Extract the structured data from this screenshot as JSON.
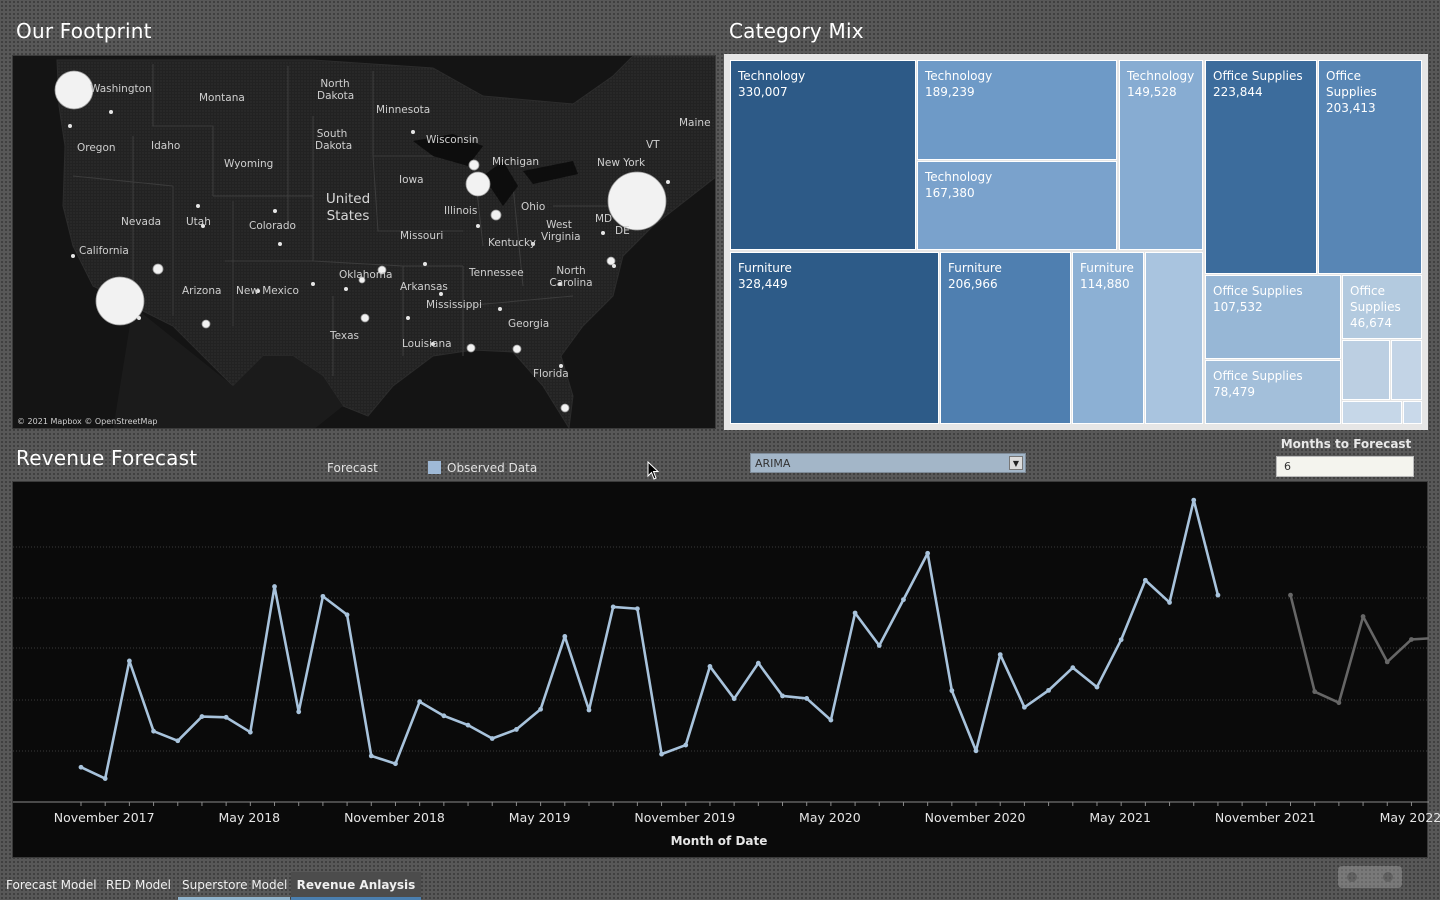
{
  "footprint": {
    "title": "Our Footprint",
    "credit": "© 2021 Mapbox © OpenStreetMap",
    "country_label": "United States",
    "state_labels": [
      "Washington",
      "Montana",
      "North Dakota",
      "Minnesota",
      "Oregon",
      "Idaho",
      "Wyoming",
      "South Dakota",
      "Wisconsin",
      "Michigan",
      "New York",
      "Maine",
      "VT",
      "Iowa",
      "Nevada",
      "Utah",
      "Colorado",
      "Illinois",
      "Ohio",
      "MD",
      "DE",
      "West Virginia",
      "Kentucky",
      "Missouri",
      "California",
      "Oklahoma",
      "Tennessee",
      "North Carolina",
      "Arkansas",
      "Arizona",
      "New Mexico",
      "Mississippi",
      "Georgia",
      "Texas",
      "Louisiana",
      "Florida"
    ]
  },
  "category_mix": {
    "title": "Category Mix",
    "tiles": [
      {
        "category": "Technology",
        "value": "330,007",
        "color": "#2d5a87"
      },
      {
        "category": "Technology",
        "value": "189,239",
        "color": "#6e9ac7"
      },
      {
        "category": "Technology",
        "value": "149,528",
        "color": "#87acd2"
      },
      {
        "category": "Technology",
        "value": "167,380",
        "color": "#7aa2cc"
      },
      {
        "category": "Furniture",
        "value": "328,449",
        "color": "#2d5b88"
      },
      {
        "category": "Furniture",
        "value": "206,966",
        "color": "#4f7fb0"
      },
      {
        "category": "Furniture",
        "value": "114,880",
        "color": "#8cb0d4"
      },
      {
        "category": "",
        "value": "",
        "color": "#a9c4df"
      },
      {
        "category": "Office Supplies",
        "value": "223,844",
        "color": "#3c6c9c"
      },
      {
        "category": "Office Supplies",
        "value": "203,413",
        "color": "#5886b5"
      },
      {
        "category": "Office Supplies",
        "value": "107,532",
        "color": "#97b7d6"
      },
      {
        "category": "Office Supplies",
        "value": "46,674",
        "color": "#b3cadf"
      },
      {
        "category": "Office Supplies",
        "value": "78,479",
        "color": "#a3bfda"
      },
      {
        "category": "",
        "value": "",
        "color": "#bccfe2"
      },
      {
        "category": "",
        "value": "",
        "color": "#c3d4e6"
      },
      {
        "category": "",
        "value": "",
        "color": "#c6d7e8"
      },
      {
        "category": "",
        "value": "",
        "color": "#c9d9ea"
      }
    ]
  },
  "forecast": {
    "title": "Revenue Forecast",
    "legend_forecast": "Forecast",
    "legend_observed": "Observed Data",
    "method_value": "ARIMA",
    "months_label": "Months to Forecast",
    "months_value": "6",
    "observed_color": "#a8c3dc",
    "forecast_color": "#666666"
  },
  "chart_data": {
    "type": "line",
    "xlabel": "Month of Date",
    "ylabel": "",
    "x_tick_labels": [
      "November 2017",
      "May 2018",
      "November 2018",
      "May 2019",
      "November 2019",
      "May 2020",
      "November 2020",
      "May 2021",
      "November 2021",
      "May 2022"
    ],
    "x_start": "2017-10",
    "x_end": "2022-07",
    "ylim": [
      0,
      11
    ],
    "series": [
      {
        "values": [
          1.34,
          0.89,
          5.56,
          2.77,
          2.39,
          3.35,
          3.32,
          2.73,
          8.51,
          3.54,
          8.12,
          7.39,
          1.79,
          1.48,
          3.94,
          3.38,
          3.01,
          2.48,
          2.84,
          3.64,
          6.53,
          3.61,
          7.7,
          7.63,
          1.86,
          2.22,
          5.34,
          4.06,
          5.47,
          4.17,
          4.07,
          3.21,
          7.46,
          6.17,
          7.99,
          9.83,
          4.38,
          1.99,
          5.81,
          3.72,
          4.39,
          5.29,
          4.52,
          6.4,
          8.76,
          7.88,
          11.94,
          8.17
        ],
        "start": "2017-10"
      },
      {
        "values": [
          8.17,
          4.34,
          3.9,
          7.32,
          5.52,
          6.41,
          6.47
        ],
        "start": "2021-12"
      }
    ]
  },
  "tabs": [
    "Forecast Model",
    "RED Model",
    "Superstore Model",
    "Revenue Anlaysis"
  ]
}
